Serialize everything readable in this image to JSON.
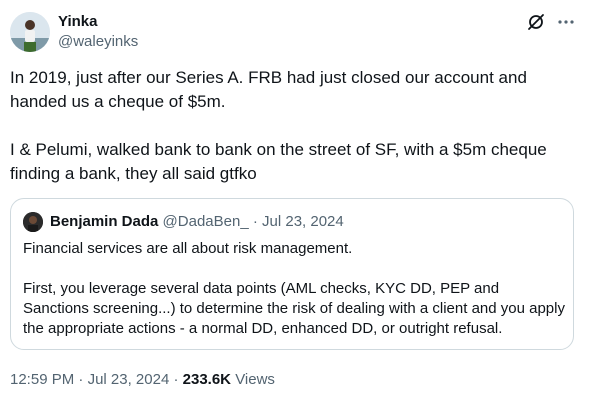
{
  "author": {
    "name": "Yinka",
    "handle": "@waleyinks",
    "icon": "avatar"
  },
  "actions": {
    "grok_icon": "grok-icon",
    "more_icon": "more-icon"
  },
  "tweet": {
    "paragraph1": "In 2019, just after our Series A. FRB had just closed our account and handed us a cheque of $5m.",
    "paragraph2": "I & Pelumi, walked bank to bank on the street of SF, with a $5m cheque finding a bank, they all said gtfko"
  },
  "quoted": {
    "name": "Benjamin Dada",
    "handle": "@DadaBen_",
    "separator": "·",
    "date": "Jul 23, 2024",
    "paragraph1": "Financial services are all about risk management.",
    "paragraph2": "First, you leverage several data points (AML checks, KYC DD, PEP and Sanctions screening...) to determine the risk of dealing with a client and you apply the appropriate actions - a normal DD, enhanced DD, or outright refusal."
  },
  "meta": {
    "time": "12:59 PM",
    "separator": "·",
    "date": "Jul 23, 2024",
    "views_count": "233.6K",
    "views_label": "Views"
  },
  "colors": {
    "text": "#0f1419",
    "secondary": "#536471",
    "border": "#cfd9de"
  }
}
